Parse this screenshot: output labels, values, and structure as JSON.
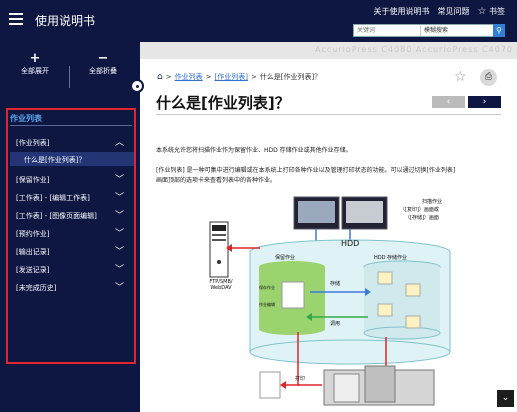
{
  "header": {
    "app_title": "使用说明书",
    "link_about": "关于使用说明书",
    "link_faq": "常见问题",
    "bookmark_label": "书签",
    "search_placeholder": "关键词",
    "search_mode": "模糊搜索"
  },
  "sidebar": {
    "expand_all": "全部展开",
    "collapse_all": "全部折叠",
    "section_title": "作业列表",
    "items": [
      {
        "label": "[作业列表]",
        "expanded": true
      },
      {
        "label": "什么是[作业列表]？",
        "selected": true
      },
      {
        "label": "[保留作业]"
      },
      {
        "label": "[工作表] - [编辑工作表]"
      },
      {
        "label": "[工作表] - [图像页面编辑]"
      },
      {
        "label": "[预约作业]"
      },
      {
        "label": "[输出记录]"
      },
      {
        "label": "[发送记录]"
      },
      {
        "label": "[未完成历史]"
      }
    ]
  },
  "content": {
    "blurred_brand": "AccurioPress C4080 AccurioPress C4070",
    "breadcrumb": [
      "作业列表",
      "[作业列表]",
      "什么是[作业列表]？"
    ],
    "page_title": "什么是[作业列表]？",
    "paragraph_1": "本系统允许您将扫描作业作为保留作业、HDD 存储作业或其他作业存储。",
    "paragraph_2_line1": "[作业列表] 是一种可集中进行编辑或在本系统上打印各种作业以及管理打印状态的功能。可以通过切换[作业列表]",
    "paragraph_2_line2": "画面顶部的选项卡来查看列表中的各种作业。"
  },
  "diagram": {
    "scan_job_label": "扫描作业",
    "scan_job_sub_1": "（[复印]）画面或",
    "scan_job_sub_2": "（[存储]）画面",
    "hdd": "HDD",
    "hdd_job": "HDD 存储作业",
    "hold_job": "保留作业",
    "store": "存储",
    "recall": "调用",
    "server": "FTP/SMB/ WebDAV",
    "print": "打印",
    "side_label_1": "保存作业",
    "side_label_2": "作业编辑"
  }
}
